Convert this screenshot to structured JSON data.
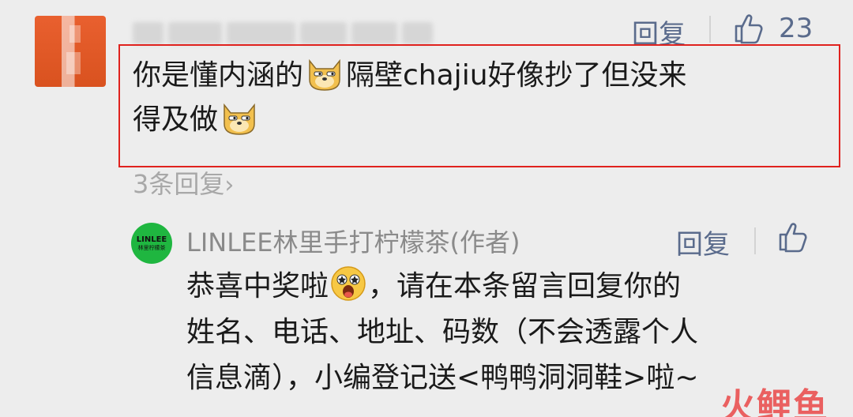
{
  "top_comment": {
    "reply_label": "回复",
    "like_count": "23",
    "text_line1_a": "你是懂内涵的",
    "text_line1_b": "隔壁chajiu好像抄了但没来",
    "text_line2": "得及做",
    "more_replies": "3条回复"
  },
  "author_reply": {
    "avatar_brand": "LINLEE",
    "avatar_sub": "林里柠檬茶",
    "name": "LINLEE林里手打柠檬茶(作者)",
    "reply_label": "回复",
    "text_line1_a": "恭喜中奖啦",
    "text_line1_b": "，请在本条留言回复你的",
    "text_line2": "姓名、电话、地址、码数（不会透露个人",
    "text_line3": "信息滴），小编登记送<鸭鸭洞洞鞋>啦~"
  },
  "watermark": "火鲤鱼",
  "colors": {
    "background": "#ededed",
    "link": "#5a6b8c",
    "highlight_box": "#e0221e",
    "author_avatar": "#1fb640"
  }
}
